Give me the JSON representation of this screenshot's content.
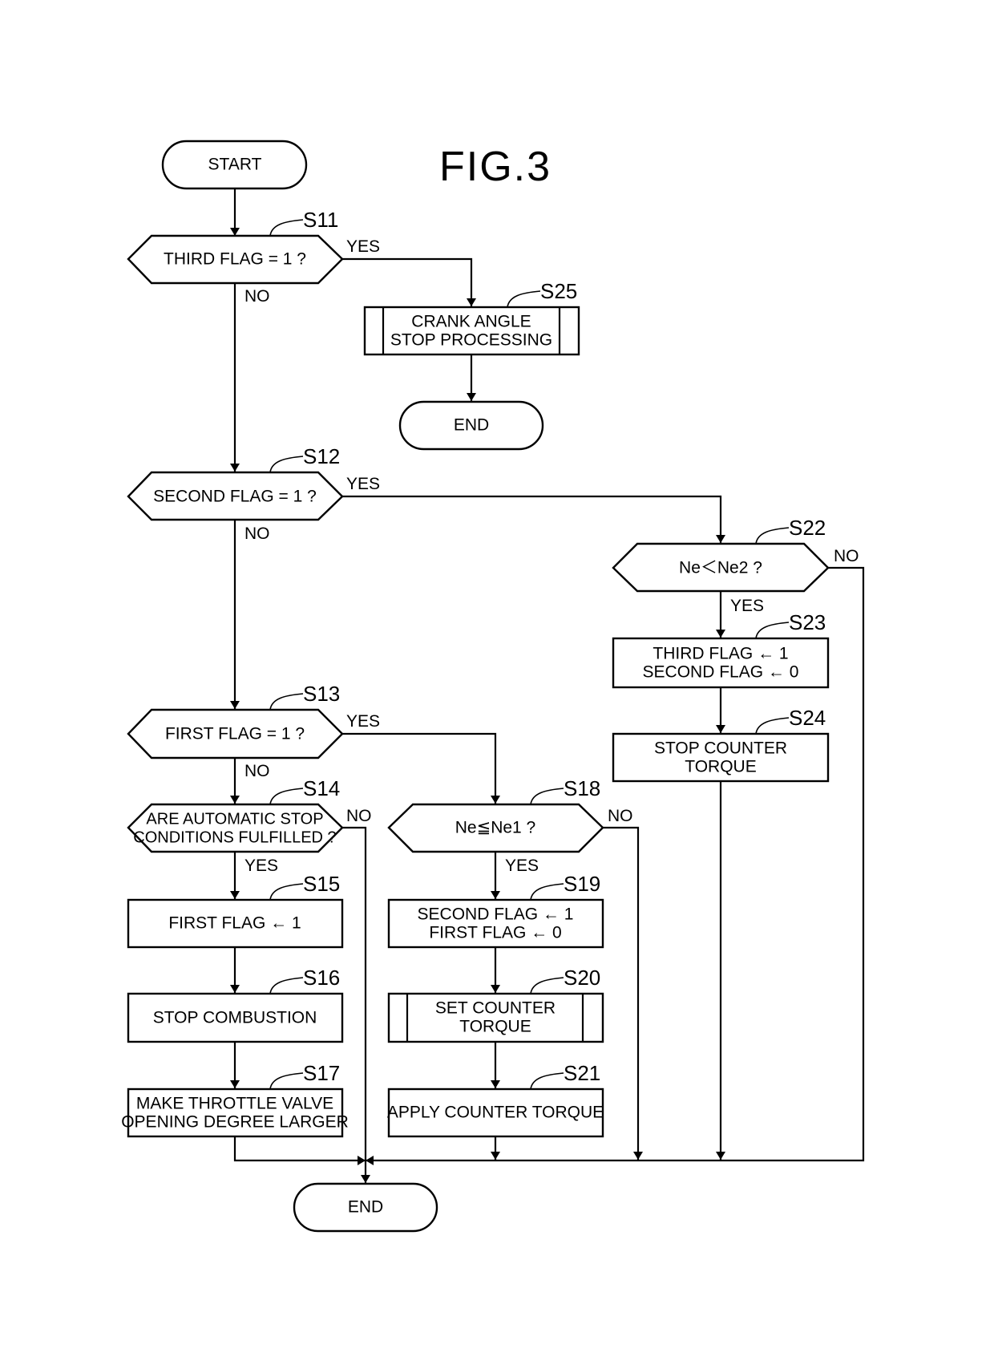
{
  "figure": {
    "title": "FIG.3"
  },
  "labels": {
    "yes": "YES",
    "no": "NO"
  },
  "nodes": {
    "start": {
      "text": "START"
    },
    "s11": {
      "step": "S11",
      "lines": [
        "THIRD FLAG = 1 ?"
      ]
    },
    "s25": {
      "step": "S25",
      "lines": [
        "CRANK ANGLE",
        "STOP PROCESSING"
      ]
    },
    "end_top": {
      "text": "END"
    },
    "s12": {
      "step": "S12",
      "lines": [
        "SECOND FLAG = 1 ?"
      ]
    },
    "s22": {
      "step": "S22",
      "lines": [
        "Ne＜Ne2 ?"
      ]
    },
    "s23": {
      "step": "S23",
      "lines": [
        "THIRD FLAG ← 1",
        "SECOND FLAG ← 0"
      ]
    },
    "s24": {
      "step": "S24",
      "lines": [
        "STOP COUNTER",
        "TORQUE"
      ]
    },
    "s13": {
      "step": "S13",
      "lines": [
        "FIRST FLAG = 1 ?"
      ]
    },
    "s14": {
      "step": "S14",
      "lines": [
        "ARE AUTOMATIC STOP",
        "CONDITIONS FULFILLED ?"
      ]
    },
    "s15": {
      "step": "S15",
      "lines": [
        "FIRST FLAG ← 1"
      ]
    },
    "s16": {
      "step": "S16",
      "lines": [
        "STOP COMBUSTION"
      ]
    },
    "s17": {
      "step": "S17",
      "lines": [
        "MAKE THROTTLE VALVE",
        "OPENING DEGREE LARGER"
      ]
    },
    "s18": {
      "step": "S18",
      "lines": [
        "Ne≦Ne1 ?"
      ]
    },
    "s19": {
      "step": "S19",
      "lines": [
        "SECOND FLAG ← 1",
        "FIRST FLAG ← 0"
      ]
    },
    "s20": {
      "step": "S20",
      "lines": [
        "SET COUNTER",
        "TORQUE"
      ]
    },
    "s21": {
      "step": "S21",
      "lines": [
        "APPLY COUNTER TORQUE"
      ]
    },
    "end_bottom": {
      "text": "END"
    }
  }
}
